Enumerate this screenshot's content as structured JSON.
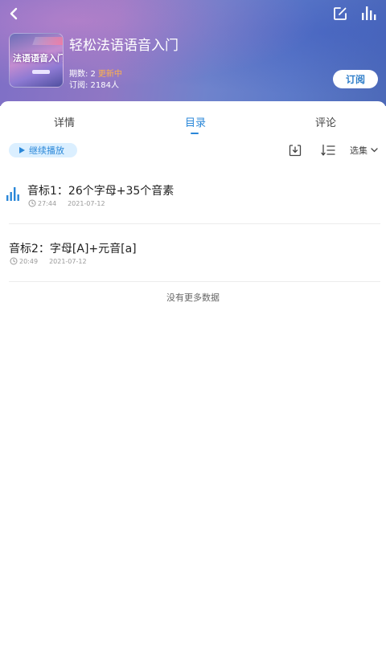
{
  "header": {
    "course_title": "轻松法语语音入门",
    "cover_text": "法语语音入门",
    "issues_label": "期数: 2",
    "update_status": "更新中",
    "subscribers": "订阅: 2184人",
    "subscribe_label": "订阅"
  },
  "tabs": [
    {
      "label": "详情"
    },
    {
      "label": "目录"
    },
    {
      "label": "评论"
    }
  ],
  "toolbar": {
    "continue_label": "继续播放",
    "select_label": "选集"
  },
  "episodes": [
    {
      "title": "音标1：26个字母+35个音素",
      "duration": "27:44",
      "date": "2021-07-12"
    },
    {
      "title": "音标2：字母[A]+元音[a]",
      "duration": "20:49",
      "date": "2021-07-12"
    }
  ],
  "footer": {
    "no_more": "没有更多数据"
  },
  "colors": {
    "accent": "#2a87d8",
    "updating": "#ffb34a"
  }
}
